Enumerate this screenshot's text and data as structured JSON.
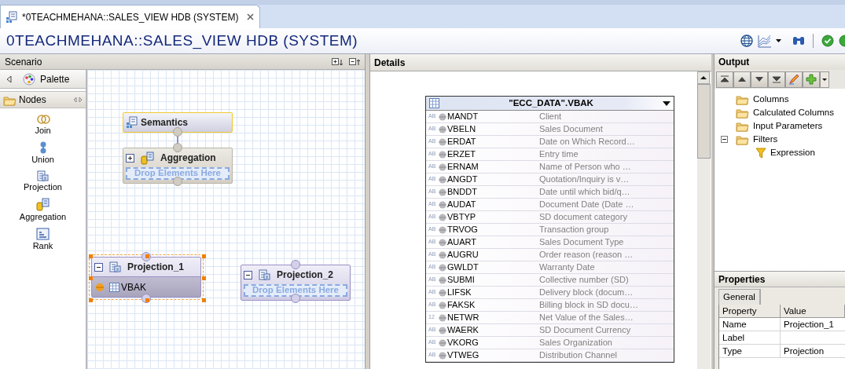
{
  "editor_tab": {
    "label": "*0TEACHMEHANA::SALES_VIEW HDB (SYSTEM)",
    "selected": true
  },
  "editor_title": "0TEACHMEHANA::SALES_VIEW HDB (SYSTEM)",
  "scenario": {
    "title": "Scenario",
    "palette": {
      "title": "Palette",
      "drawer": "Nodes",
      "items": [
        {
          "kind": "join",
          "label": "Join"
        },
        {
          "kind": "union",
          "label": "Union"
        },
        {
          "kind": "projection",
          "label": "Projection"
        },
        {
          "kind": "aggregation",
          "label": "Aggregation"
        },
        {
          "kind": "rank",
          "label": "Rank"
        }
      ]
    },
    "nodes": [
      {
        "kind": "semantics",
        "title": "Semantics",
        "selected": false
      },
      {
        "kind": "aggregation",
        "title": "Aggregation",
        "expanded": false,
        "selected": false,
        "drop_hint": "Drop Elements Here"
      },
      {
        "kind": "projection",
        "title": "Projection_1",
        "expanded": true,
        "selected": true,
        "inputs": [
          "VBAK"
        ]
      },
      {
        "kind": "projection",
        "title": "Projection_2",
        "expanded": true,
        "selected": false,
        "drop_hint": "Drop Elements Here"
      }
    ]
  },
  "details": {
    "title": "Details",
    "table": {
      "title": "\"ECC_DATA\".VBAK",
      "columns": [
        {
          "type": "AB",
          "name": "MANDT",
          "description": "Client"
        },
        {
          "type": "AB",
          "name": "VBELN",
          "description": "Sales Document"
        },
        {
          "type": "AB",
          "name": "ERDAT",
          "description": "Date on Which Record…"
        },
        {
          "type": "AB",
          "name": "ERZET",
          "description": "Entry time"
        },
        {
          "type": "AB",
          "name": "ERNAM",
          "description": "Name of Person who …"
        },
        {
          "type": "AB",
          "name": "ANGDT",
          "description": "Quotation/Inquiry is v…"
        },
        {
          "type": "AB",
          "name": "BNDDT",
          "description": "Date until which bid/q…"
        },
        {
          "type": "AB",
          "name": "AUDAT",
          "description": "Document Date (Date …"
        },
        {
          "type": "AB",
          "name": "VBTYP",
          "description": "SD document category"
        },
        {
          "type": "AB",
          "name": "TRVOG",
          "description": "Transaction group"
        },
        {
          "type": "AB",
          "name": "AUART",
          "description": "Sales Document Type"
        },
        {
          "type": "AB",
          "name": "AUGRU",
          "description": "Order reason (reason …"
        },
        {
          "type": "AB",
          "name": "GWLDT",
          "description": "Warranty Date"
        },
        {
          "type": "AB",
          "name": "SUBMI",
          "description": "Collective number (SD)"
        },
        {
          "type": "AB",
          "name": "LIFSK",
          "description": "Delivery block (docum…"
        },
        {
          "type": "AB",
          "name": "FAKSK",
          "description": "Billing block in SD docu…"
        },
        {
          "type": "12",
          "name": "NETWR",
          "description": "Net Value of the Sales…"
        },
        {
          "type": "AB",
          "name": "WAERK",
          "description": "SD Document Currency"
        },
        {
          "type": "AB",
          "name": "VKORG",
          "description": "Sales Organization"
        },
        {
          "type": "AB",
          "name": "VTWEG",
          "description": "Distribution Channel"
        }
      ]
    }
  },
  "output": {
    "title": "Output",
    "tree": [
      {
        "label": "Columns"
      },
      {
        "label": "Calculated Columns"
      },
      {
        "label": "Input Parameters"
      },
      {
        "label": "Filters",
        "expanded": true,
        "children": [
          {
            "label": "Expression",
            "kind": "filter"
          }
        ]
      }
    ]
  },
  "properties": {
    "title": "Properties",
    "tabs": [
      {
        "label": "General",
        "selected": true
      }
    ],
    "columns": [
      "Property",
      "Value"
    ],
    "rows": [
      {
        "property": "Name",
        "value": "Projection_1"
      },
      {
        "property": "Label",
        "value": ""
      },
      {
        "property": "Type",
        "value": "Projection"
      }
    ]
  }
}
